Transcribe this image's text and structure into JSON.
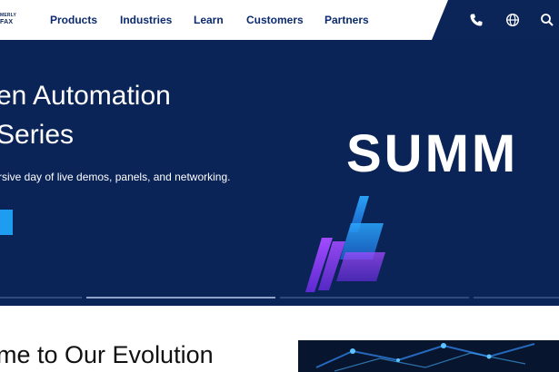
{
  "brand": {
    "logo_line1": "MERLY",
    "logo_line2": "FAX"
  },
  "nav": {
    "items": [
      "Products",
      "Industries",
      "Learn",
      "Customers",
      "Partners"
    ],
    "icons": [
      "phone-icon",
      "globe-icon",
      "search-icon"
    ]
  },
  "hero": {
    "title_line1": "en Automation",
    "title_line2": "Series",
    "subtitle": "rsive day of live demos, panels, and networking.",
    "logo_text": "SUMM",
    "slide_count": 4,
    "active_slide": 2
  },
  "section": {
    "heading": "me to Our Evolution"
  },
  "colors": {
    "navy": "#0a2458",
    "nav_text": "#0b2a6f",
    "accent_blue": "#1e9cf0",
    "graphic_purple": "#8b3cf0"
  }
}
